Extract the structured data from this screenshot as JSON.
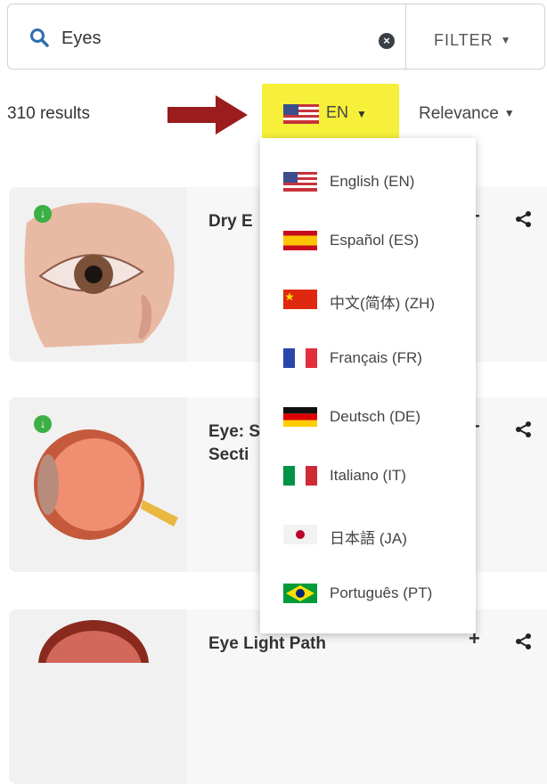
{
  "search": {
    "query": "Eyes",
    "clear_icon": "clear-icon",
    "filter_label": "FILTER"
  },
  "results": {
    "count_label": "310 results",
    "sort_label": "Relevance"
  },
  "language": {
    "current_code": "EN",
    "highlight_color": "#f6f03a",
    "arrow_color": "#9b1c1c"
  },
  "language_menu": {
    "items": [
      {
        "label": "English (EN)",
        "flag": "us-flag-icon"
      },
      {
        "label": "Español (ES)",
        "flag": "spain-flag-icon"
      },
      {
        "label": "中文(简体) (ZH)",
        "flag": "china-flag-icon"
      },
      {
        "label": "Français (FR)",
        "flag": "france-flag-icon"
      },
      {
        "label": "Deutsch (DE)",
        "flag": "germany-flag-icon"
      },
      {
        "label": "Italiano (IT)",
        "flag": "italy-flag-icon"
      },
      {
        "label": "日本語 (JA)",
        "flag": "japan-flag-icon"
      },
      {
        "label": "Português (PT)",
        "flag": "brazil-flag-icon"
      }
    ]
  },
  "cards": [
    {
      "title": "Dry E",
      "thumb": "eye-closeup-image"
    },
    {
      "title_line1": "Eye: S",
      "title_line2": "Secti",
      "thumb": "eyeball-cross-section-image"
    },
    {
      "title": "Eye Light Path",
      "thumb": "eye-light-path-image"
    }
  ]
}
